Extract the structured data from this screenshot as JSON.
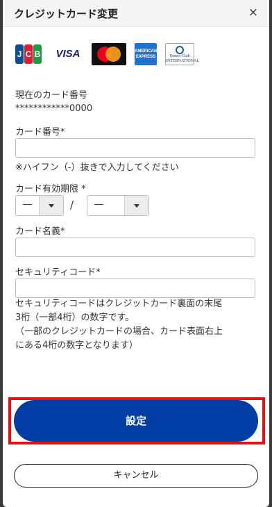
{
  "modal": {
    "title": "クレジットカード変更",
    "close_glyph": "×"
  },
  "brands": {
    "jcb_letters": [
      "J",
      "C",
      "B"
    ],
    "visa": "VISA",
    "mastercard": "mastercard-logo",
    "amex_lines": [
      "AMERICAN",
      "EXPRESS"
    ],
    "diners_lines": [
      "Diners Club",
      "INTERNATIONAL"
    ]
  },
  "current_card": {
    "label": "現在のカード番号",
    "value": "************0000"
  },
  "card_number": {
    "label": "カード番号*",
    "value": "",
    "note": "※ハイフン（-）抜きで入力してください"
  },
  "expiry": {
    "label": "カード有効期限 *",
    "month_value": "―",
    "year_value": "―",
    "separator": "/"
  },
  "card_name": {
    "label": "カード名義*",
    "value": ""
  },
  "security_code": {
    "label": "セキュリティコード*",
    "value": "",
    "description": [
      "セキュリティコードはクレジットカード裏面の末尾",
      "3桁（一部4桁）の数字です。",
      "（一部のクレジットカードの場合、カード表面右上",
      "にある4桁の数字となります）"
    ]
  },
  "actions": {
    "submit_label": "設定",
    "cancel_label": "キャンセル"
  },
  "colors": {
    "primary": "#003da5",
    "highlight": "#e01212"
  }
}
